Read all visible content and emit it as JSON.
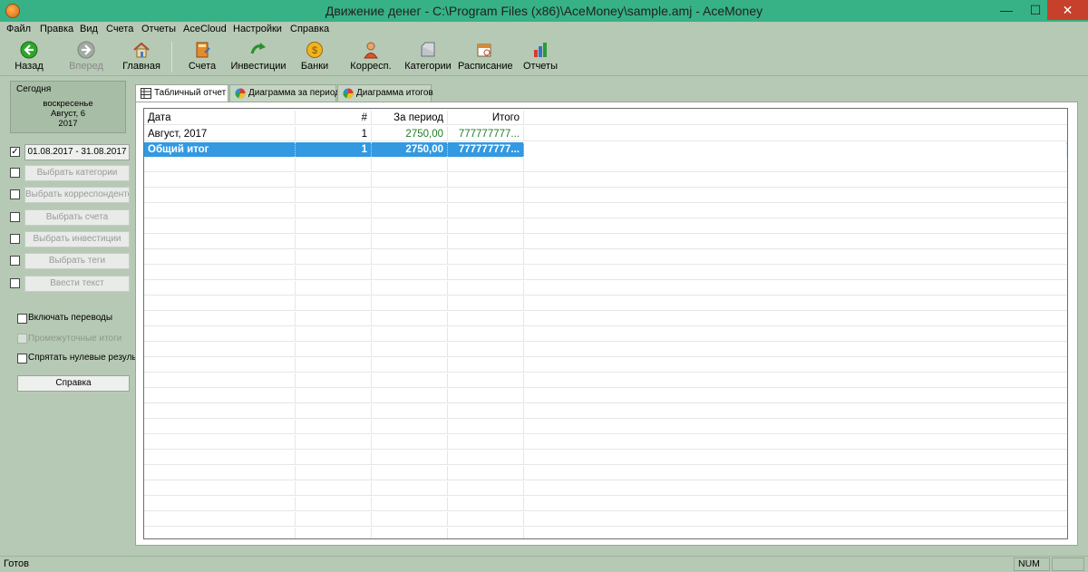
{
  "window": {
    "title": "Движение денег - C:\\Program Files (x86)\\AceMoney\\sample.amj - AceMoney",
    "minimize": "—",
    "maximize": "☐",
    "close": "✕"
  },
  "menu": [
    "Файл",
    "Правка",
    "Вид",
    "Счета",
    "Отчеты",
    "AceCloud",
    "Настройки",
    "Справка"
  ],
  "toolbar": {
    "back": "Назад",
    "forward": "Вперед",
    "home": "Главная",
    "accounts": "Счета",
    "investments": "Инвестиции",
    "banks": "Банки",
    "payees": "Корресп.",
    "categories": "Категории",
    "schedule": "Расписание",
    "reports": "Отчеты"
  },
  "sidebar": {
    "today_caption": "Сегодня",
    "today_weekday": "воскресенье",
    "today_date": "Август, 6",
    "today_year": "2017",
    "date_range": "01.08.2017 - 31.08.2017",
    "date_range_checked": "✓",
    "filters": {
      "categories": "Выбрать категории",
      "payees": "Выбрать корреспондентов",
      "accounts": "Выбрать счета",
      "investments": "Выбрать инвестиции",
      "tags": "Выбрать теги",
      "text": "Ввести текст"
    },
    "include_transfers": "Включать переводы",
    "subtotals": "Промежуточные итоги",
    "hide_zero": "Спрятать нулевые резуль",
    "help": "Справка"
  },
  "tabs": {
    "table": "Табличный отчет",
    "period_chart": "Диаграмма за период",
    "totals_chart": "Диаграмма итогов"
  },
  "table": {
    "headers": {
      "date": "Дата",
      "count": "#",
      "period": "За период",
      "total": "Итого"
    },
    "rows": [
      {
        "date": "Август, 2017",
        "count": "1",
        "period": "2750,00",
        "total": "777777777..."
      }
    ],
    "grand_total": {
      "date": "Общий итог",
      "count": "1",
      "period": "2750,00",
      "total": "777777777..."
    }
  },
  "status": {
    "text": "Готов",
    "num": "NUM"
  },
  "colors": {
    "titlebar": "#36b286",
    "chrome": "#b6c9b4",
    "selection": "#3399e0",
    "positive_amount": "#1d7d25"
  }
}
